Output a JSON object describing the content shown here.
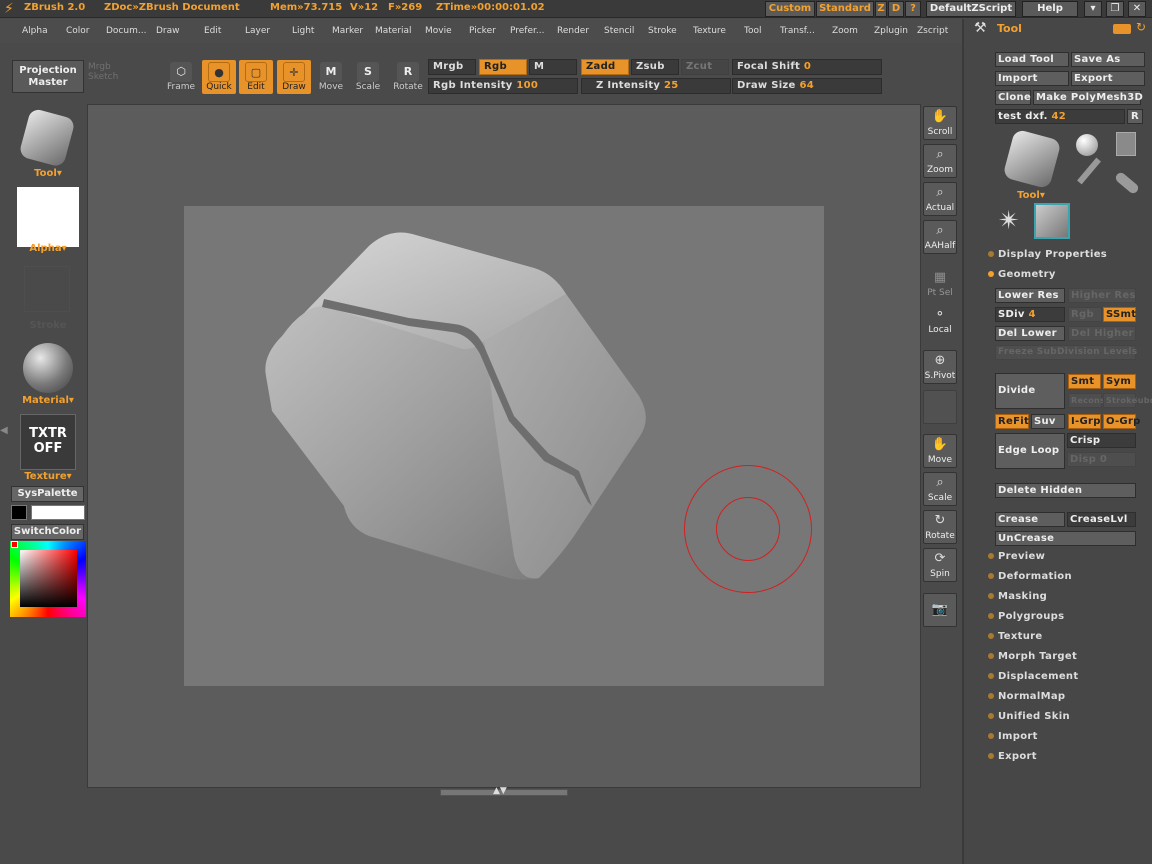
{
  "title": {
    "app": "ZBrush 2.0",
    "doc": "ZDoc»ZBrush Document",
    "mem": "Mem»73.715",
    "verts": "V»12",
    "faces": "F»269",
    "ztime": "ZTime»00:00:01.02",
    "btn_custom": "Custom",
    "btn_standard": "Standard",
    "btn_z": "Z",
    "btn_d": "D",
    "btn_q": "?",
    "script": "DefaultZScript",
    "help": "Help"
  },
  "menus": [
    "Alpha",
    "Color",
    "Docum...",
    "Draw",
    "Edit",
    "Layer",
    "Light",
    "Marker",
    "Material",
    "Movie",
    "Picker",
    "Prefer...",
    "Render",
    "Stencil",
    "Stroke",
    "Texture",
    "Tool",
    "Transf...",
    "Zoom",
    "Zplugin",
    "Zscript"
  ],
  "toolbar": {
    "projection": "Projection Master",
    "lightbox_a": "Mrgb",
    "lightbox_b": "Sketch",
    "frame": "Frame",
    "quick": "Quick",
    "edit": "Edit",
    "draw": "Draw",
    "move": "Move",
    "scale": "Scale",
    "rotate": "Rotate",
    "mrgb": "Mrgb",
    "rgb": "Rgb",
    "m": "M",
    "zadd": "Zadd",
    "zsub": "Zsub",
    "zcut": "Zcut",
    "rgb_intensity_label": "Rgb Intensity",
    "rgb_intensity_value": "100",
    "z_intensity_label": "Z Intensity",
    "z_intensity_value": "25",
    "focal_shift_label": "Focal Shift",
    "focal_shift_value": "0",
    "draw_size_label": "Draw Size",
    "draw_size_value": "64"
  },
  "left": {
    "tool": "Tool",
    "alpha": "Alpha",
    "stroke": "Stroke",
    "material": "Material",
    "txtr": "TXTR",
    "off": "OFF",
    "texture": "Texture",
    "syspalette": "SysPalette",
    "switchcolor": "SwitchColor"
  },
  "nav": {
    "scroll": "Scroll",
    "zoom": "Zoom",
    "actual": "Actual",
    "aahalf": "AAHalf",
    "ptsel": "Pt Sel",
    "local": "Local",
    "spivot": "S.Pivot",
    "move": "Move",
    "scale": "Scale",
    "rotate": "Rotate",
    "spin": "Spin"
  },
  "panel": {
    "title": "Tool",
    "load_tool": "Load Tool",
    "save_as": "Save As",
    "import": "Import",
    "export": "Export",
    "clone": "Clone",
    "make_polymesh": "Make PolyMesh3D",
    "tool_name": "test dxf.",
    "tool_value": "42",
    "r": "R",
    "tool_caption": "Tool",
    "display_props": "Display Properties",
    "geometry": "Geometry",
    "lower_res": "Lower Res",
    "higher_res": "Higher Res",
    "sdiv_label": "SDiv",
    "sdiv_value": "4",
    "rgb_dim": "Rgb",
    "ssmt": "SSmt",
    "del_lower": "Del Lower",
    "del_higher": "Del Higher",
    "freeze": "Freeze SubDivision Levels",
    "divide": "Divide",
    "smt": "Smt",
    "sym": "Sym",
    "reconstruct": "Reconstruct Subdiv",
    "stroke_dim": "Stroke",
    "refit": "ReFit",
    "suv": "Suv",
    "igrp": "I-Grp",
    "ogrp": "O-Grp",
    "edge_loop": "Edge Loop",
    "crisp": "Crisp",
    "disp": "Disp",
    "disp_value": "0",
    "delete_hidden": "Delete Hidden",
    "crease": "Crease",
    "creaselvl": "CreaseLvl",
    "uncrease": "UnCrease",
    "sections": [
      "Preview",
      "Deformation",
      "Masking",
      "Polygroups",
      "Texture",
      "Morph Target",
      "Displacement",
      "NormalMap",
      "Unified Skin",
      "Import",
      "Export"
    ]
  },
  "colors": {
    "accent": "#f3a12e",
    "canvas": "#777777",
    "brush": "#d22020"
  }
}
